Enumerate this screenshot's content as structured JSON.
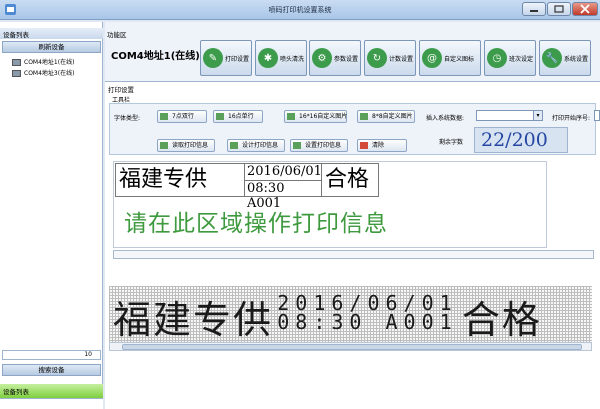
{
  "window": {
    "title": "喷码打印机设置系统"
  },
  "left": {
    "header": "设备列表",
    "refresh_button": "刷新设备",
    "devices": [
      "COM4地址1(在线)",
      "COM4地址3(在线)"
    ],
    "spin_value": "10",
    "search_button": "搜索设备",
    "bottom_header": "设备列表"
  },
  "function_area": {
    "header": "功能区",
    "device_label": "COM4地址1(在线)",
    "buttons": [
      "打印设置",
      "喷头清洗",
      "参数设置",
      "计数设置",
      "自定义图标",
      "班次设定",
      "系统设置"
    ]
  },
  "print_settings": {
    "header": "打印设置",
    "toolbar_header": "工具栏",
    "font_type_label": "字体类型:",
    "buttons": {
      "dual7": "7点双行",
      "single16": "16点单行",
      "custom16": "16*16自定义图片",
      "custom8": "8*8自定义图片",
      "read": "读取打印信息",
      "design": "设计打印信息",
      "set": "设置打印信息",
      "clear": "清除"
    },
    "insert_label": "插入系统数据:",
    "start_label": "打印开始序号:",
    "remaining_label": "剩余字数",
    "remaining_value": "22/200"
  },
  "editor": {
    "text1": "福建专供",
    "date": "2016/06/01",
    "time_code": "08:30 A001",
    "status": "合格",
    "hint": "请在此区域操作打印信息"
  },
  "preview": {
    "text": "福建专供",
    "line1": "2016/06/01",
    "line2": "08:30 A001",
    "status": "合格"
  }
}
